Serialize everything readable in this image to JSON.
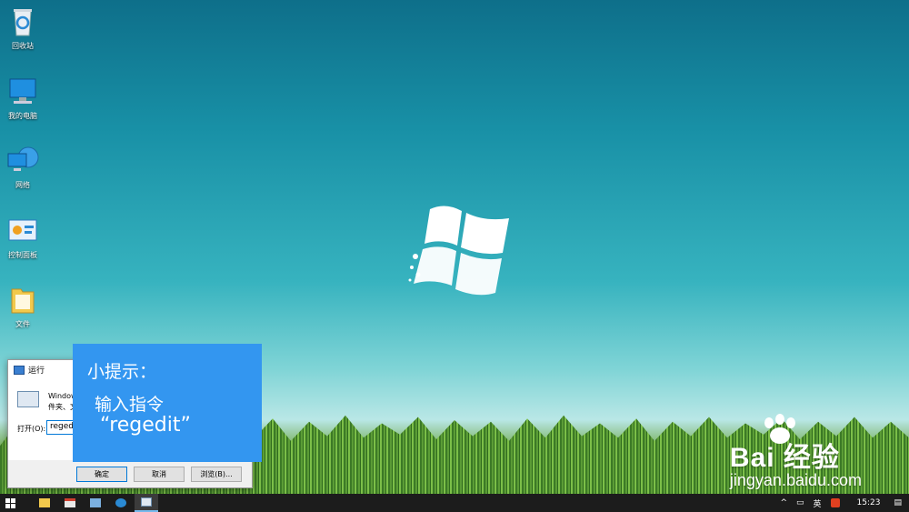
{
  "desktop_icons": [
    {
      "label": "回收站",
      "icon": "recycle-bin-icon"
    },
    {
      "label": "我的电脑",
      "icon": "computer-icon"
    },
    {
      "label": "网络",
      "icon": "network-icon"
    },
    {
      "label": "控制面板",
      "icon": "control-panel-icon"
    },
    {
      "label": "文件",
      "icon": "folder-icon"
    }
  ],
  "run_dialog": {
    "title": "运行",
    "desc_line1": "Window",
    "desc_line2": "件夹、文",
    "open_label": "打开(O):",
    "input_value": "regedi",
    "ok_label": "确定",
    "cancel_label": "取消",
    "browse_label": "浏览(B)..."
  },
  "tip": {
    "heading": "小提示：",
    "line1": "输入指令",
    "line2": "“regedit”"
  },
  "watermark": {
    "brand": "Bai  经验",
    "url": "jingyan.baidu.com"
  },
  "taskbar": {
    "ime": "英",
    "time": "15:23"
  },
  "colors": {
    "tip_bg": "#3396f0",
    "taskbar_bg": "#1c1c1c",
    "accent": "#0078d7"
  }
}
